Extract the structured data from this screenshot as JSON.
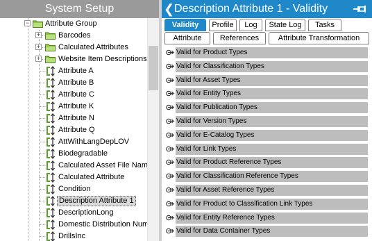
{
  "left_panel": {
    "title": "System Setup",
    "items": [
      {
        "label": "Attribute Group",
        "kind": "folder"
      },
      {
        "label": "Barcodes",
        "kind": "folder"
      },
      {
        "label": "Calculated Attributes",
        "kind": "folder"
      },
      {
        "label": "Website Item Descriptions",
        "kind": "folder"
      },
      {
        "label": "Attribute A",
        "kind": "attribute"
      },
      {
        "label": "Attribute B",
        "kind": "attribute"
      },
      {
        "label": "Attribute C",
        "kind": "attribute"
      },
      {
        "label": "Attribute K",
        "kind": "attribute"
      },
      {
        "label": "Attribute N",
        "kind": "attribute"
      },
      {
        "label": "Attribute Q",
        "kind": "attribute"
      },
      {
        "label": "AttWithLangDepLOV",
        "kind": "attribute"
      },
      {
        "label": "Biodegradable",
        "kind": "attribute"
      },
      {
        "label": "Calculated Asset File Name",
        "kind": "attribute"
      },
      {
        "label": "Calculated Attribute",
        "kind": "attribute"
      },
      {
        "label": "Condition",
        "kind": "attribute"
      },
      {
        "label": "Description Attribute 1",
        "kind": "attribute",
        "selected": true
      },
      {
        "label": "DescriptionLong",
        "kind": "attribute"
      },
      {
        "label": "Domestic Distribution Numb",
        "kind": "attribute"
      },
      {
        "label": "DrillsInc",
        "kind": "attribute"
      }
    ],
    "expander_symbol": "−",
    "expander_plus": "+"
  },
  "right_panel": {
    "back_symbol": "❮",
    "title": "Description Attribute 1 - Validity",
    "tabs_row1": [
      "Validity",
      "Profile",
      "Log",
      "State Log",
      "Tasks"
    ],
    "tabs_row2": [
      "Attribute",
      "References",
      "Attribute Transformation"
    ],
    "active_tab": "Validity",
    "validity_items": [
      "Valid for Product Types",
      "Valid for Classification Types",
      "Valid for Asset Types",
      "Valid for Entity Types",
      "Valid for Publication Types",
      "Valid for Version Types",
      "Valid for E-Catalog Types",
      "Valid for Link Types",
      "Valid for Product Reference Types",
      "Valid for Classification Reference Types",
      "Valid for Asset Reference Types",
      "Valid for Product to Classification Link Types",
      "Valid for Entity Reference Types",
      "Valid for Data Container Types"
    ]
  },
  "colors": {
    "header_blue": "#1f88c9",
    "left_header_gray": "#9a9a9a",
    "row_gray": "#bdbdbd",
    "folder_green": "#8cc63f",
    "attribute_green": "#5aa02c"
  },
  "icons": {
    "folder": "folder-icon",
    "attribute": "attribute-icon",
    "expand": "expand-arrow-icon",
    "pin": "pin-icon",
    "back": "back-arrow-icon"
  }
}
